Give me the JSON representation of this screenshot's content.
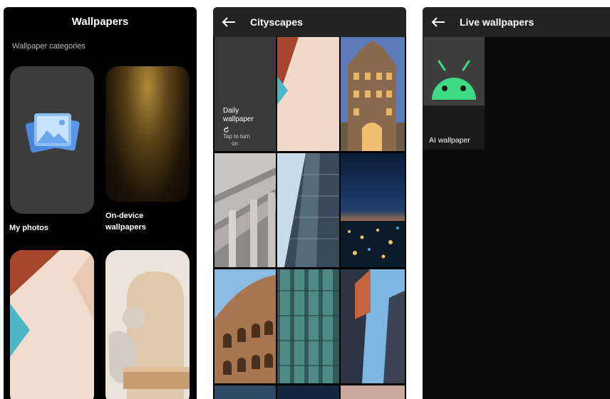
{
  "screen1": {
    "title": "Wallpapers",
    "subtitle": "Wallpaper categories",
    "cards": [
      {
        "label": "My photos"
      },
      {
        "label_line1": "On-device",
        "label_line2": "wallpapers"
      }
    ]
  },
  "screen2": {
    "title": "Cityscapes",
    "daily": {
      "line1": "Daily",
      "line2": "wallpaper",
      "action_line1": "Tap to turn",
      "action_line2": "on"
    }
  },
  "screen3": {
    "title": "Live wallpapers",
    "tiles": [
      {
        "label": "AI wallpaper"
      }
    ]
  },
  "colors": {
    "android_green": "#3ddc84",
    "header_bg": "#232323",
    "screen_bg": "#000000"
  },
  "icons": [
    "back-arrow-icon",
    "photos-icon",
    "refresh-icon",
    "android-icon"
  ]
}
